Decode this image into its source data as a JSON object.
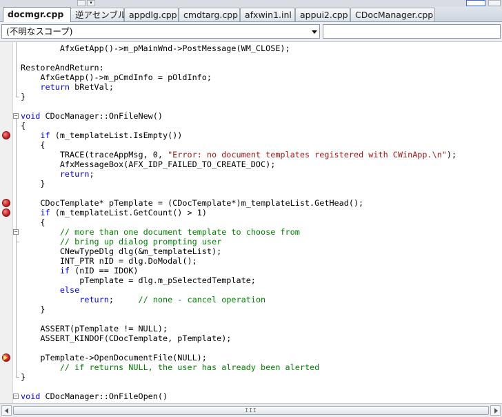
{
  "tabs": [
    {
      "label": "docmgr.cpp",
      "active": true
    },
    {
      "label": "逆アセンブル",
      "active": false
    },
    {
      "label": "appdlg.cpp",
      "active": false
    },
    {
      "label": "cmdtarg.cpp",
      "active": false
    },
    {
      "label": "afxwin1.inl",
      "active": false
    },
    {
      "label": "appui2.cpp",
      "active": false
    },
    {
      "label": "CDocManager.cpp",
      "active": false
    }
  ],
  "scope": {
    "value": "(不明なスコープ)",
    "member_value": ""
  },
  "code": {
    "lines": [
      "        AfxGetApp()->m_pMainWnd->PostMessage(WM_CLOSE);",
      "",
      "RestoreAndReturn:",
      "    AfxGetApp()->m_pCmdInfo = pOldInfo;",
      "    return bRetVal;",
      "}",
      "",
      "void CDocManager::OnFileNew()",
      "{",
      "    if (m_templateList.IsEmpty())",
      "    {",
      "        TRACE(traceAppMsg, 0, \"Error: no document templates registered with CWinApp.\\n\");",
      "        AfxMessageBox(AFX_IDP_FAILED_TO_CREATE_DOC);",
      "        return;",
      "    }",
      "",
      "    CDocTemplate* pTemplate = (CDocTemplate*)m_templateList.GetHead();",
      "    if (m_templateList.GetCount() > 1)",
      "    {",
      "        // more than one document template to choose from",
      "        // bring up dialog prompting user",
      "        CNewTypeDlg dlg(&m_templateList);",
      "        INT_PTR nID = dlg.DoModal();",
      "        if (nID == IDOK)",
      "            pTemplate = dlg.m_pSelectedTemplate;",
      "        else",
      "            return;     // none - cancel operation",
      "    }",
      "",
      "    ASSERT(pTemplate != NULL);",
      "    ASSERT_KINDOF(CDocTemplate, pTemplate);",
      "",
      "    pTemplate->OpenDocumentFile(NULL);",
      "        // if returns NULL, the user has already been alerted",
      "}",
      "",
      "void CDocManager::OnFileOpen()"
    ],
    "breakpoint_lines": [
      9,
      16,
      17
    ],
    "current_statement_line": 32,
    "fold_marks": [
      "⊟",
      "⊟",
      "⊟"
    ]
  },
  "colors": {
    "keyword": "#0000ff",
    "string": "#a31515",
    "comment": "#008000",
    "breakpoint": "#c81e1e",
    "current_arrow": "#ffe15c"
  },
  "scrollbar": {
    "grip": "III"
  }
}
